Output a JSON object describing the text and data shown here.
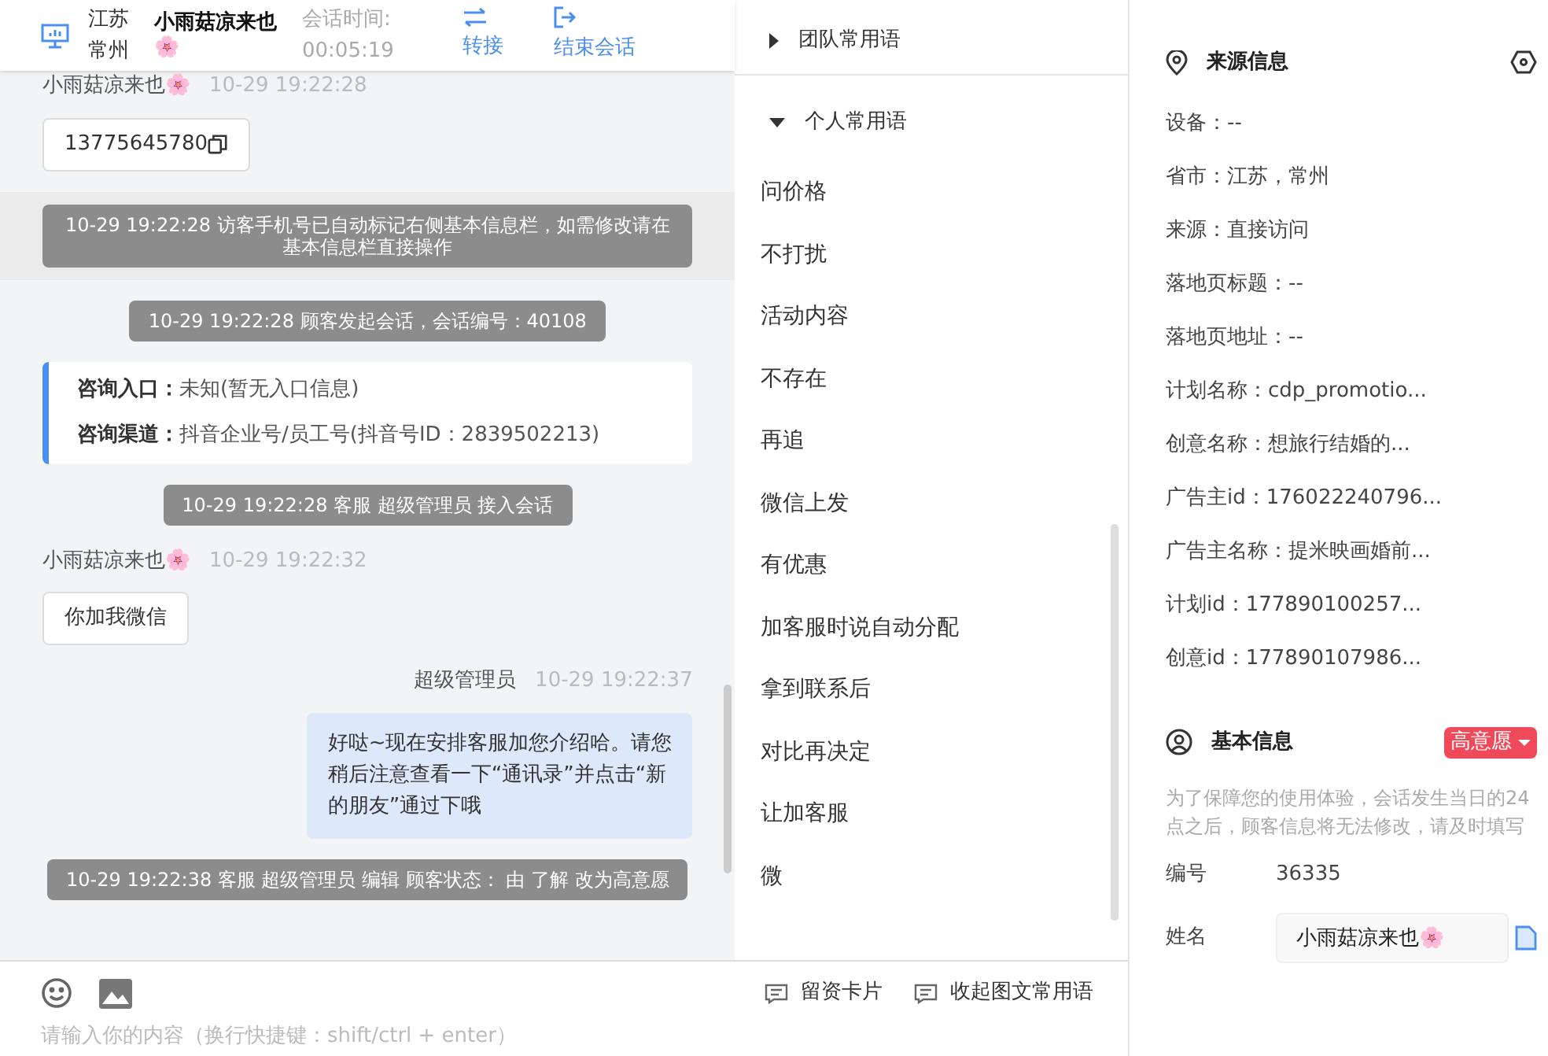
{
  "chat_header": {
    "location": "江苏常州",
    "visitor_name": "小雨菇凉来也🌸",
    "session_time_label": "会话时间:",
    "session_time": "00:05:19",
    "actions": [
      {
        "kind": "transfer",
        "label": "转接"
      },
      {
        "kind": "end",
        "label": "结束会话"
      }
    ]
  },
  "messages": [
    {
      "kind": "customer",
      "sender": "小雨菇凉来也🌸",
      "time": "10-29 19:22:28",
      "text": "13775645780",
      "copyable": true
    },
    {
      "kind": "system",
      "text": "10-29 19:22:28 访客手机号已自动标记右侧基本信息栏，如需修改请在基本信息栏直接操作",
      "highlighted": true
    },
    {
      "kind": "system",
      "text": "10-29 19:22:28 顾客发起会话，会话编号：40108",
      "highlighted": false
    },
    {
      "kind": "info",
      "rows": [
        {
          "label": "咨询入口：",
          "value": "未知(暂无入口信息)"
        },
        {
          "label": "咨询渠道：",
          "value": "抖音企业号/员工号(抖音号ID：2839502213)"
        }
      ]
    },
    {
      "kind": "system",
      "text": "10-29 19:22:28 客服 超级管理员 接入会话",
      "highlighted": false
    },
    {
      "kind": "customer",
      "sender": "小雨菇凉来也🌸",
      "time": "10-29 19:22:32",
      "text": "你加我微信",
      "copyable": false
    },
    {
      "kind": "agent",
      "sender": "超级管理员",
      "time": "10-29 19:22:37",
      "text": "好哒~现在安排客服加您介绍哈。请您稍后注意查看一下“通讯录”并点击“新的朋友”通过下哦"
    },
    {
      "kind": "system",
      "text": "10-29 19:22:38 客服 超级管理员 编辑 顾客状态： 由 了解 改为高意愿",
      "highlighted": false
    }
  ],
  "phrases": {
    "groups": [
      {
        "title": "团队常用语",
        "expanded": false
      },
      {
        "title": "个人常用语",
        "expanded": true
      }
    ],
    "items": [
      "问价格",
      "不打扰",
      "活动内容",
      "不存在",
      "再追",
      "微信上发",
      "有优惠",
      "加客服时说自动分配",
      "拿到联系后",
      "对比再决定",
      "让加客服",
      "微"
    ]
  },
  "input_bar": {
    "actions": [
      "留资卡片",
      "收起图文常用语"
    ],
    "placeholder": "请输入你的内容（换行快捷键：shift/ctrl + enter）"
  },
  "source_info": {
    "title": "来源信息",
    "rows": [
      "设备：--",
      "省市：江苏，常州",
      "来源：直接访问",
      "落地页标题：--",
      "落地页地址：--",
      "计划名称：cdp_promotio...",
      "创意名称：想旅行结婚的...",
      "广告主id：176022240796...",
      "广告主名称：提米映画婚前...",
      "计划id：177890100257...",
      "创意id：177890107986..."
    ]
  },
  "basic_info": {
    "title": "基本信息",
    "status": "高意愿",
    "note": "为了保障您的使用体验，会话发生当日的24点之后，顾客信息将无法修改，请及时填写",
    "fields": [
      {
        "label": "编号",
        "value": "36335",
        "kind": "text"
      },
      {
        "label": "姓名",
        "value": "小雨菇凉来也🌸",
        "kind": "input"
      }
    ]
  }
}
